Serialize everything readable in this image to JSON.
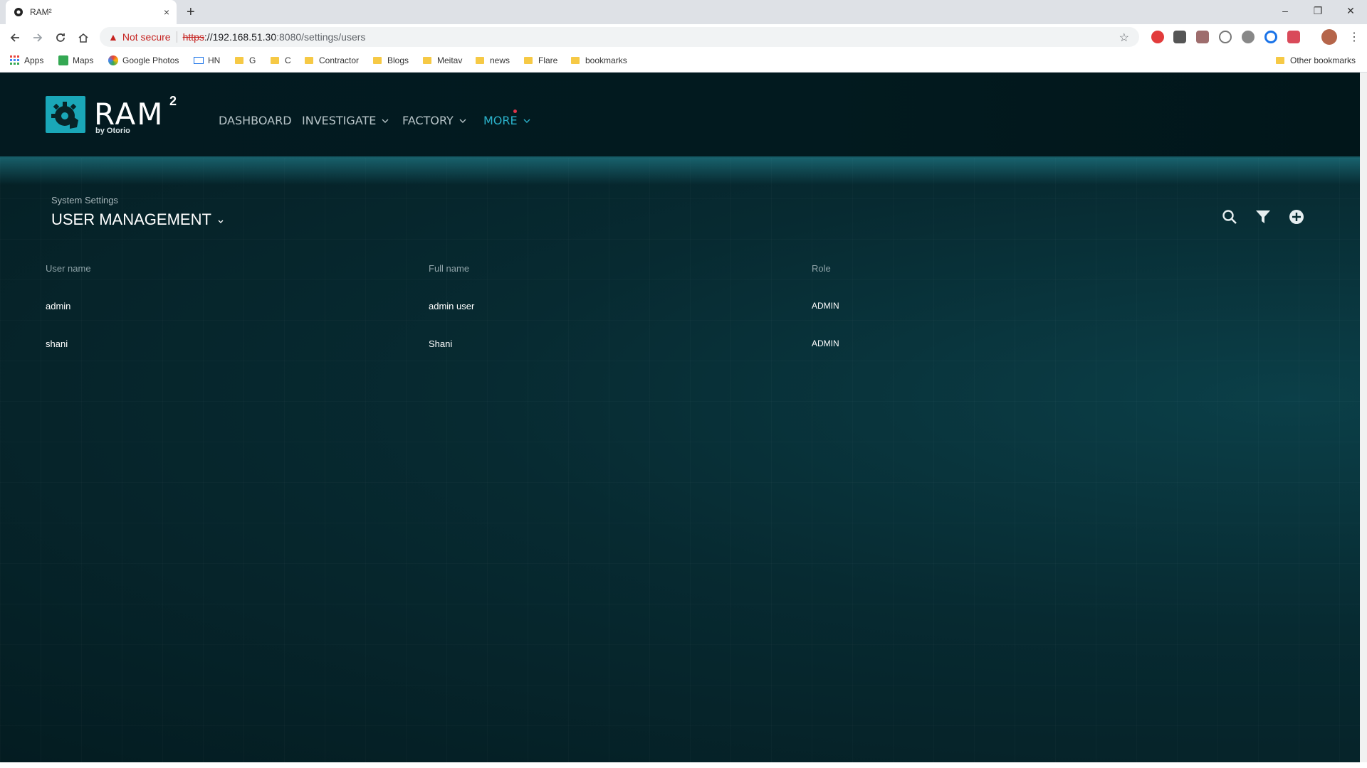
{
  "browser": {
    "tab_title": "RAM²",
    "new_tab": "+",
    "tab_close": "×",
    "window_controls": {
      "minimize": "–",
      "restore": "❐",
      "close": "✕"
    },
    "security_label": "Not secure",
    "url_protocol": "https",
    "url_host": "://192.168.51.30",
    "url_path": ":8080/settings/users",
    "bookmarks": [
      {
        "label": "Apps",
        "icon": "apps-grid-icon"
      },
      {
        "label": "Maps",
        "icon": "maps-icon"
      },
      {
        "label": "Google Photos",
        "icon": "google-photos-icon"
      },
      {
        "label": "HN",
        "icon": "mail-icon"
      },
      {
        "label": "G",
        "icon": "folder-icon"
      },
      {
        "label": "C",
        "icon": "folder-icon"
      },
      {
        "label": "Contractor",
        "icon": "folder-icon"
      },
      {
        "label": "Blogs",
        "icon": "folder-icon"
      },
      {
        "label": "Meitav",
        "icon": "folder-icon"
      },
      {
        "label": "news",
        "icon": "folder-icon"
      },
      {
        "label": "Flare",
        "icon": "folder-icon"
      },
      {
        "label": "bookmarks",
        "icon": "folder-icon"
      }
    ],
    "other_bookmarks": "Other bookmarks"
  },
  "app": {
    "logo_text": "RAM",
    "logo_sup": "2",
    "logo_by": "by Otorio",
    "nav": {
      "dashboard": "DASHBOARD",
      "investigate": "INVESTIGATE",
      "factory": "FACTORY",
      "more": "MORE"
    },
    "breadcrumb": "System Settings",
    "title": "USER MANAGEMENT",
    "columns": [
      "User name",
      "Full name",
      "Role"
    ],
    "users": [
      {
        "username": "admin",
        "fullname": "admin user",
        "role": "ADMIN"
      },
      {
        "username": "shani",
        "fullname": "Shani",
        "role": "ADMIN"
      }
    ],
    "colors": {
      "accent": "#2bb3cc",
      "logo_bg": "#1aa7b8",
      "notification_dot": "#e0344a"
    }
  }
}
